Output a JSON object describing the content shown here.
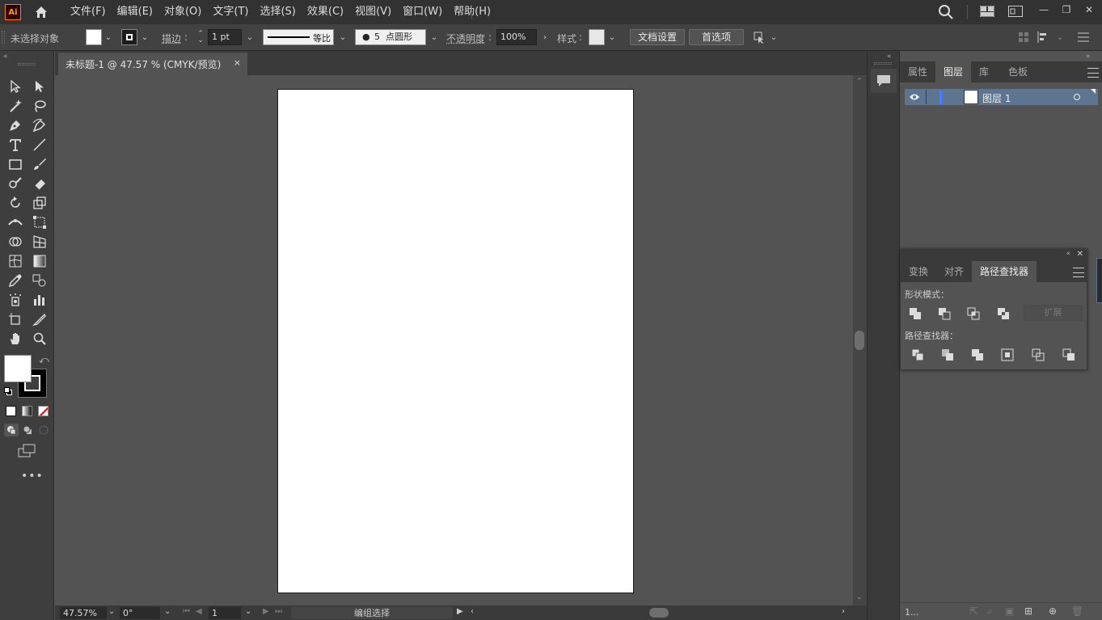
{
  "app": {
    "logo": "Ai"
  },
  "menu": [
    "文件(F)",
    "编辑(E)",
    "对象(O)",
    "文字(T)",
    "选择(S)",
    "效果(C)",
    "视图(V)",
    "窗口(W)",
    "帮助(H)"
  ],
  "control": {
    "selection_status": "未选择对象",
    "stroke_label": "描边",
    "stroke_weight": "1 pt",
    "stroke_profile": "等比",
    "brush_size": "5",
    "brush_label": "点圆形",
    "opacity_label": "不透明度",
    "opacity_value": "100%",
    "style_label": "样式",
    "doc_setup_button": "文档设置",
    "preferences_button": "首选项"
  },
  "document": {
    "tab_title": "未标题-1 @ 47.57 % (CMYK/预览)",
    "close_glyph": "×"
  },
  "status": {
    "zoom": "47.57%",
    "rotation": "0°",
    "artboard_number": "1",
    "tool_status": "编组选择"
  },
  "panels": {
    "top_tabs": [
      "属性",
      "图层",
      "库",
      "色板"
    ],
    "active_top_tab": "图层",
    "layer_name": "图层 1",
    "layer_count_text": "1...",
    "bottom_tabs": [
      "变换",
      "对齐",
      "路径查找器"
    ],
    "active_bottom_tab": "路径查找器",
    "shape_modes_label": "形状模式：",
    "expand_button": "扩展",
    "pathfinders_label": "路径查找器："
  },
  "colors": {
    "accent_layer": "#5d7591",
    "layer_color_bar": "#4b7bff",
    "fill_color": "#ffffff",
    "stroke_color": "#000000",
    "logo_orange": "#ff7c00"
  }
}
